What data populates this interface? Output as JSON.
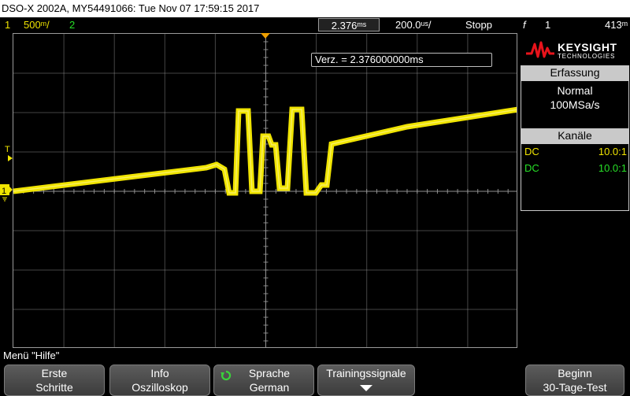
{
  "title": "DSO-X 2002A, MY54491066: Tue Nov 07 17:59:15 2017",
  "status": {
    "ch1_num": "1",
    "ch1_scale": "500ᵐ/",
    "ch2_num": "2",
    "time_ref": "2.376ᵐˢ",
    "timebase": "200.0ᵘˢ/",
    "run_state": "Stopp",
    "trigger_symbol": "f",
    "trigger_ch": "1",
    "trigger_level": "413ᵐ"
  },
  "delay_readout": "Verz. = 2.376000000ms",
  "markers": {
    "trigger_level": "T",
    "ch1_ground": "1"
  },
  "logo": {
    "brand": "KEYSIGHT",
    "sub": "TECHNOLOGIES"
  },
  "acquisition": {
    "header": "Erfassung",
    "mode": "Normal",
    "rate": "100MSa/s"
  },
  "channels": {
    "header": "Kanäle",
    "rows": [
      {
        "coupling": "DC",
        "probe": "10.0:1",
        "color": "#f0e400"
      },
      {
        "coupling": "DC",
        "probe": "10.0:1",
        "color": "#27e027"
      }
    ]
  },
  "menu": {
    "label": "Menü \"Hilfe\""
  },
  "softkeys": [
    {
      "line1": "Erste",
      "line2": "Schritte"
    },
    {
      "line1": "Info",
      "line2": "Oszilloskop"
    },
    {
      "line1": "Sprache",
      "line2": "German"
    },
    {
      "line1": "Trainingssignale",
      "line2": ""
    },
    {
      "line1": "Beginn",
      "line2": "30-Tage-Test"
    }
  ],
  "colors": {
    "ch1": "#f0e400",
    "ch2": "#27e027",
    "trigger_marker": "#f0a000",
    "grid": "#9a9a9a"
  }
}
